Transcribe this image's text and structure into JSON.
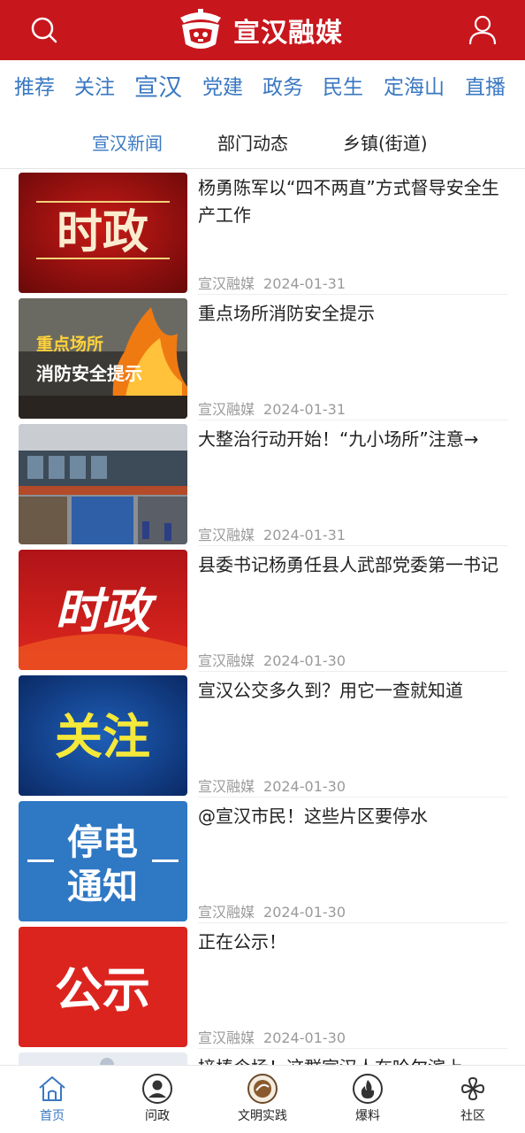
{
  "header": {
    "brand_name": "宣汉融媒",
    "search_icon": "search-icon",
    "user_icon": "user-icon",
    "background_color": "#c8161d"
  },
  "channels": [
    {
      "label": "推荐",
      "active": false
    },
    {
      "label": "关注",
      "active": false
    },
    {
      "label": "宣汉",
      "active": true
    },
    {
      "label": "党建",
      "active": false
    },
    {
      "label": "政务",
      "active": false
    },
    {
      "label": "民生",
      "active": false
    },
    {
      "label": "定海山",
      "active": false
    },
    {
      "label": "直播",
      "active": false
    }
  ],
  "subtabs": [
    {
      "label": "宣汉新闻",
      "active": true
    },
    {
      "label": "部门动态",
      "active": false
    },
    {
      "label": "乡镇(街道)",
      "active": false
    }
  ],
  "news": [
    {
      "title": "杨勇陈军以“四不两直”方式督导安全生产工作",
      "source": "宣汉融媒",
      "date": "2024-01-31",
      "thumb_text": "时政"
    },
    {
      "title": "重点场所消防安全提示",
      "source": "宣汉融媒",
      "date": "2024-01-31",
      "thumb_text_1": "重点场所",
      "thumb_text_2": "消防安全提示"
    },
    {
      "title": "大整治行动开始！“九小场所”注意→",
      "source": "宣汉融媒",
      "date": "2024-01-31"
    },
    {
      "title": "县委书记杨勇任县人武部党委第一书记",
      "source": "宣汉融媒",
      "date": "2024-01-30",
      "thumb_text": "时政"
    },
    {
      "title": "宣汉公交多久到？用它一查就知道",
      "source": "宣汉融媒",
      "date": "2024-01-30",
      "thumb_text": "关注"
    },
    {
      "title": "@宣汉市民！这些片区要停水",
      "source": "宣汉融媒",
      "date": "2024-01-30",
      "thumb_text_1": "停电",
      "thumb_text_2": "通知"
    },
    {
      "title": "正在公示！",
      "source": "宣汉融媒",
      "date": "2024-01-30",
      "thumb_text": "公示"
    },
    {
      "title": "接棒令场！这群宣汉人在哈尔滨上",
      "source": "",
      "date": ""
    }
  ],
  "bottom_nav": [
    {
      "label": "首页",
      "icon": "home-icon",
      "active": true
    },
    {
      "label": "问政",
      "icon": "person-circle-icon",
      "active": false
    },
    {
      "label": "文明实践",
      "icon": "civilization-practice-badge-icon",
      "active": false
    },
    {
      "label": "爆料",
      "icon": "flame-circle-icon",
      "active": false
    },
    {
      "label": "社区",
      "icon": "clover-icon",
      "active": false
    }
  ],
  "colors": {
    "accent_blue": "#3a78c2",
    "brand_red": "#c8161d",
    "meta_gray": "#9a9a9a"
  }
}
